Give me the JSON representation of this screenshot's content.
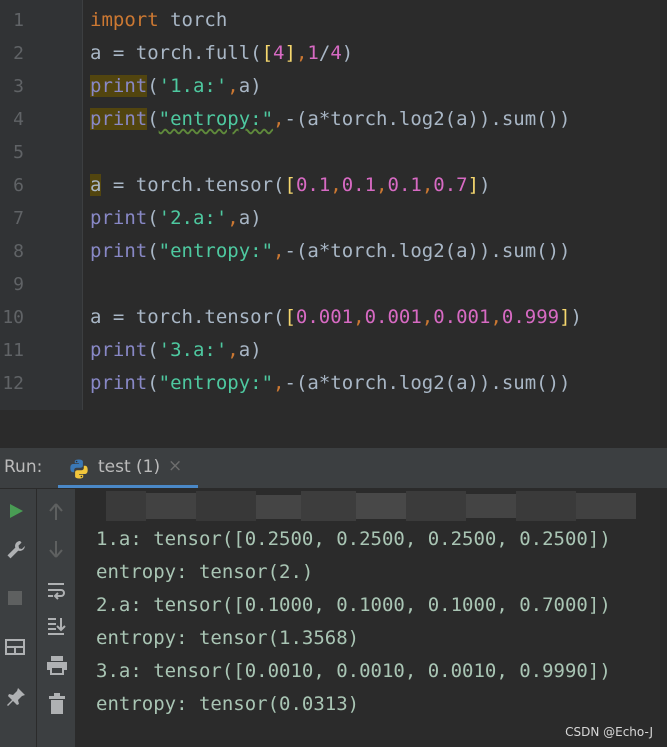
{
  "editor": {
    "line_numbers": [
      "1",
      "2",
      "3",
      "4",
      "5",
      "6",
      "7",
      "8",
      "9",
      "10",
      "11",
      "12"
    ],
    "lines": [
      [
        {
          "t": "import",
          "c": "kw"
        },
        {
          "t": " torch",
          "c": "pl"
        }
      ],
      [
        {
          "t": "a = torch.full(",
          "c": "pl"
        },
        {
          "t": "[",
          "c": "bl"
        },
        {
          "t": "4",
          "c": "num"
        },
        {
          "t": "]",
          "c": "bl"
        },
        {
          "t": ",",
          "c": "kw"
        },
        {
          "t": "1",
          "c": "num"
        },
        {
          "t": "/",
          "c": "pl"
        },
        {
          "t": "4",
          "c": "num"
        },
        {
          "t": ")",
          "c": "pl"
        }
      ],
      [
        {
          "t": "print",
          "c": "fn hl"
        },
        {
          "t": "(",
          "c": "pl"
        },
        {
          "t": "'1.a:'",
          "c": "str"
        },
        {
          "t": ",",
          "c": "kw"
        },
        {
          "t": "a)",
          "c": "pl"
        }
      ],
      [
        {
          "t": "print",
          "c": "fn hl"
        },
        {
          "t": "(",
          "c": "pl"
        },
        {
          "t": "\"entropy:\"",
          "c": "str uw"
        },
        {
          "t": ",",
          "c": "kw"
        },
        {
          "t": "-(a*torch.log2(a)).sum())",
          "c": "pl"
        }
      ],
      [],
      [
        {
          "t": "a",
          "c": "pl hl"
        },
        {
          "t": " = torch.tensor(",
          "c": "pl"
        },
        {
          "t": "[",
          "c": "bl"
        },
        {
          "t": "0.1",
          "c": "num"
        },
        {
          "t": ",",
          "c": "kw"
        },
        {
          "t": "0.1",
          "c": "num"
        },
        {
          "t": ",",
          "c": "kw"
        },
        {
          "t": "0.1",
          "c": "num"
        },
        {
          "t": ",",
          "c": "kw"
        },
        {
          "t": "0.7",
          "c": "num"
        },
        {
          "t": "]",
          "c": "bl"
        },
        {
          "t": ")",
          "c": "pl"
        }
      ],
      [
        {
          "t": "print",
          "c": "fn"
        },
        {
          "t": "(",
          "c": "pl"
        },
        {
          "t": "'2.a:'",
          "c": "str"
        },
        {
          "t": ",",
          "c": "kw"
        },
        {
          "t": "a)",
          "c": "pl"
        }
      ],
      [
        {
          "t": "print",
          "c": "fn"
        },
        {
          "t": "(",
          "c": "pl"
        },
        {
          "t": "\"entropy:\"",
          "c": "str"
        },
        {
          "t": ",",
          "c": "kw"
        },
        {
          "t": "-(a*torch.log2(a)).sum())",
          "c": "pl"
        }
      ],
      [],
      [
        {
          "t": "a = torch.tensor(",
          "c": "pl"
        },
        {
          "t": "[",
          "c": "bl"
        },
        {
          "t": "0.001",
          "c": "num"
        },
        {
          "t": ",",
          "c": "kw"
        },
        {
          "t": "0.001",
          "c": "num"
        },
        {
          "t": ",",
          "c": "kw"
        },
        {
          "t": "0.001",
          "c": "num"
        },
        {
          "t": ",",
          "c": "kw"
        },
        {
          "t": "0.999",
          "c": "num"
        },
        {
          "t": "]",
          "c": "bl"
        },
        {
          "t": ")",
          "c": "pl"
        }
      ],
      [
        {
          "t": "print",
          "c": "fn"
        },
        {
          "t": "(",
          "c": "pl"
        },
        {
          "t": "'3.a:'",
          "c": "str"
        },
        {
          "t": ",",
          "c": "kw"
        },
        {
          "t": "a)",
          "c": "pl"
        }
      ],
      [
        {
          "t": "print",
          "c": "fn"
        },
        {
          "t": "(",
          "c": "pl"
        },
        {
          "t": "\"entropy:\"",
          "c": "str"
        },
        {
          "t": ",",
          "c": "kw"
        },
        {
          "t": "-(a*torch.log2(a)).sum())",
          "c": "pl"
        }
      ]
    ]
  },
  "run_panel": {
    "label": "Run:",
    "tab_label": "test (1)",
    "close_glyph": "×",
    "output": [
      "1.a: tensor([0.2500, 0.2500, 0.2500, 0.2500])",
      "entropy: tensor(2.)",
      "2.a: tensor([0.1000, 0.1000, 0.1000, 0.7000])",
      "entropy: tensor(1.3568)",
      "3.a: tensor([0.0010, 0.0010, 0.0010, 0.9990])",
      "entropy: tensor(0.0313)"
    ]
  },
  "toolbar": {
    "left": [
      "run-icon",
      "wrench-icon",
      "stop-icon",
      "layout-icon",
      "pin-icon"
    ],
    "second": [
      "up-arrow-icon",
      "down-arrow-icon",
      "soft-wrap-icon",
      "scroll-to-end-icon",
      "print-icon",
      "trash-icon"
    ]
  },
  "colors": {
    "keyword": "#cc7832",
    "builtin": "#8888c6",
    "number": "#d76ac3",
    "string": "#4ec9a0",
    "run_green": "#499c54"
  },
  "watermark": "CSDN @Echo-J"
}
